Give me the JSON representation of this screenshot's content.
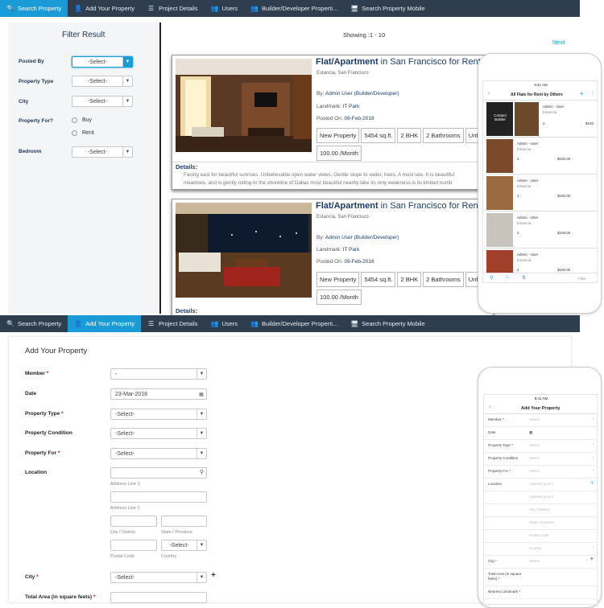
{
  "nav1": {
    "items": [
      {
        "label": "Search Property",
        "icon": "search-icon"
      },
      {
        "label": "Add Your Property",
        "icon": "add-user-icon"
      },
      {
        "label": "Project Details",
        "icon": "list-icon"
      },
      {
        "label": "Users",
        "icon": "users-icon"
      },
      {
        "label": "Builder/Developer Properti...",
        "icon": "builder-icon"
      },
      {
        "label": "Search Property Mobile",
        "icon": "monitor-icon"
      }
    ]
  },
  "nav2": {
    "items": [
      {
        "label": "Search Property",
        "icon": "search-icon"
      },
      {
        "label": "Add Your Property",
        "icon": "add-user-icon"
      },
      {
        "label": "Project Details",
        "icon": "list-icon"
      },
      {
        "label": "Users",
        "icon": "users-icon"
      },
      {
        "label": "Builder/Developer Properti...",
        "icon": "builder-icon"
      },
      {
        "label": "Search Property Mobile",
        "icon": "monitor-icon"
      }
    ]
  },
  "filter": {
    "title": "Filter Result",
    "posted_by": "Posted By",
    "property_type": "Property Type",
    "city": "City",
    "property_for": "Property For?",
    "buy": "Buy",
    "rent": "Rent",
    "bedroom": "Bedroom",
    "select": "-Select-"
  },
  "results": {
    "showing": "Showing :1 - 10",
    "next": "Next"
  },
  "cards": [
    {
      "title_bold": "Flat/Apartment",
      "title_rest": " in San Francisco for Rent",
      "location": "Estancia, San Francisco",
      "by_label": "By:",
      "by_value": "Admin User (Builder/Developer)",
      "landmark_label": "Landmark:",
      "landmark_value": "IT Park",
      "posted_label": "Posted On:",
      "posted_value": "09-Feb-2018",
      "specs": [
        "New Property",
        "5454 sq.ft.",
        "2 BHK",
        "2 Bathrooms",
        "Unfurni"
      ],
      "price": "100.00 /Month",
      "details_label": "Details:",
      "details": [
        "Facing east for beautiful sunrises. Unbelievable open water views. Gentle slope to water, trees. A must see. It is beautiful",
        "meadows, and is gently rolling to the shoreline of Dallas most beautiful nearby lake its only weakness is its limited numb"
      ]
    },
    {
      "title_bold": "Flat/Apartment",
      "title_rest": " in San Francisco for Rent",
      "location": "Estancia, San Francisco",
      "by_label": "By:",
      "by_value": "Admin User (Builder/Developer)",
      "landmark_label": "Landmark:",
      "landmark_value": "IT Park",
      "posted_label": "Posted On:",
      "posted_value": "09-Feb-2018",
      "specs": [
        "New Property",
        "5454 sq.ft.",
        "2 BHK",
        "2 Bathrooms",
        "Unfurn"
      ],
      "price": "100.00 /Month",
      "details_label": "Details:"
    }
  ],
  "phone1": {
    "time": "9:41 AM",
    "title": "All Flats for Rent by Others",
    "contact": "Contact Builder",
    "items": [
      {
        "name": "Admin - User",
        "loc": "Estancia",
        "num": "2",
        "price": "$100"
      },
      {
        "name": "Admin - User",
        "loc": "Estancia",
        "num": "2",
        "price": "$100.00"
      },
      {
        "name": "Admin - User",
        "loc": "Estancia",
        "num": "2",
        "price": "$100.00"
      },
      {
        "name": "Admin - User",
        "loc": "Estancia",
        "num": "2",
        "price": "$100.00"
      },
      {
        "name": "Admin - User",
        "loc": "Estancia",
        "num": "2",
        "price": "$100.00"
      }
    ],
    "filter": "Filter"
  },
  "addform": {
    "title": "Add Your Property",
    "member": "Member",
    "member_value": "-",
    "date": "Date",
    "date_value": "23-Mar-2018",
    "property_type": "Property Type",
    "property_condition": "Property Condition",
    "property_for": "Property For",
    "location": "Location",
    "address1": "Address Line 1",
    "address2": "Address Line 2",
    "city_district": "City / District",
    "state_province": "State / Province",
    "postal_code": "Postal Code",
    "country": "Country",
    "city": "City",
    "total_area": "Total Area (in square feets)",
    "select": "-Select-"
  },
  "phone2": {
    "time": "9:41 AM",
    "title": "Add Your Property",
    "rows": [
      {
        "label": "Member",
        "req": true,
        "value": "Select"
      },
      {
        "label": "Date",
        "req": false,
        "value": ""
      },
      {
        "label": "Property Type",
        "req": true,
        "value": "Select"
      },
      {
        "label": "Property Condition",
        "req": false,
        "value": "Select"
      },
      {
        "label": "Property For",
        "req": true,
        "value": "Select"
      },
      {
        "label": "Location",
        "req": false,
        "value": "Address Line 1"
      },
      {
        "label": "",
        "req": false,
        "value": "Address Line 2"
      },
      {
        "label": "",
        "req": false,
        "value": "City / District"
      },
      {
        "label": "",
        "req": false,
        "value": "State / Province"
      },
      {
        "label": "",
        "req": false,
        "value": "Postal Code"
      },
      {
        "label": "",
        "req": false,
        "value": "Country"
      },
      {
        "label": "City",
        "req": true,
        "value": "Select"
      },
      {
        "label": "Total Area (in square feets)",
        "req": true,
        "value": ""
      },
      {
        "label": "Nearest Landmark",
        "req": true,
        "value": ""
      }
    ]
  }
}
